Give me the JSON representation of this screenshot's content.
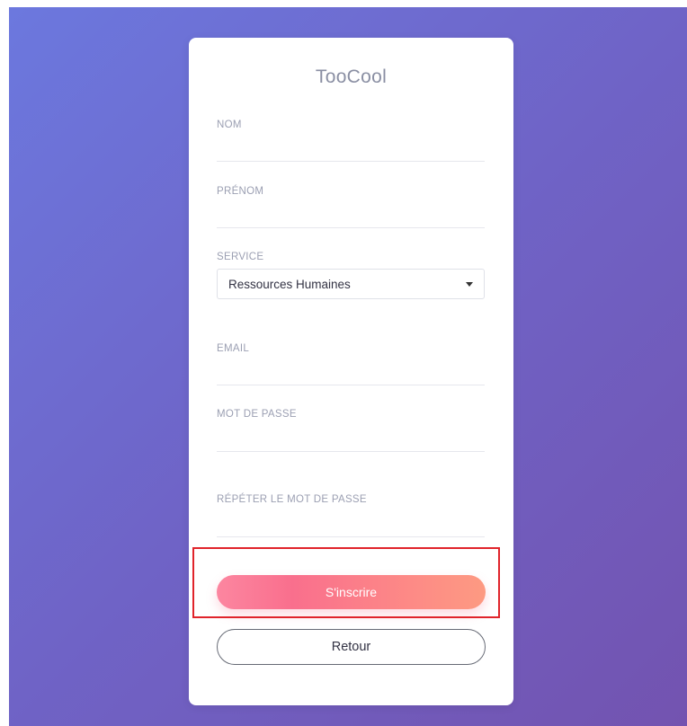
{
  "app": {
    "title": "TooCool"
  },
  "form": {
    "nom": {
      "label": "NOM",
      "value": "",
      "placeholder": ""
    },
    "prenom": {
      "label": "PRÉNOM",
      "value": "",
      "placeholder": ""
    },
    "service": {
      "label": "SERVICE",
      "selected": "Ressources Humaines"
    },
    "email": {
      "label": "EMAIL",
      "value": "",
      "placeholder": ""
    },
    "password": {
      "label": "MOT DE PASSE",
      "value": "",
      "placeholder": ""
    },
    "password_repeat": {
      "label": "RÉPÉTER LE MOT DE PASSE",
      "value": "",
      "placeholder": ""
    }
  },
  "actions": {
    "signup_label": "S'inscrire",
    "back_label": "Retour"
  },
  "colors": {
    "background_start": "#6c78de",
    "background_end": "#7353b0",
    "signup_gradient_start": "#fc86a0",
    "signup_gradient_end": "#fd9a82",
    "highlight": "#e0242b"
  }
}
